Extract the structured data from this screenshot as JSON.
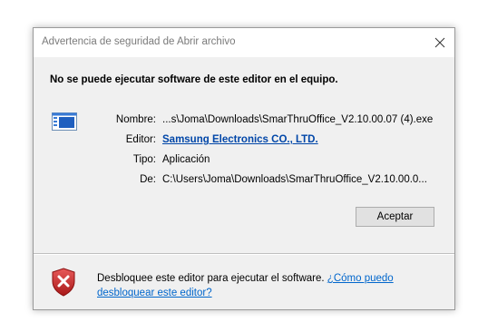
{
  "window": {
    "title": "Advertencia de seguridad de Abrir archivo",
    "close_icon": "close-icon"
  },
  "warning": "No se puede ejecutar software de este editor en el equipo.",
  "details": {
    "icon": "executable-file-icon",
    "name_label": "Nombre:",
    "name_value": "...s\\Joma\\Downloads\\SmarThruOffice_V2.10.00.07 (4).exe",
    "publisher_label": "Editor:",
    "publisher_value": "Samsung Electronics CO., LTD.",
    "type_label": "Tipo:",
    "type_value": "Aplicación",
    "from_label": "De:",
    "from_value": "C:\\Users\\Joma\\Downloads\\SmarThruOffice_V2.10.00.0..."
  },
  "buttons": {
    "accept_label": "Aceptar"
  },
  "footer": {
    "icon": "shield-error-icon",
    "text": "Desbloquee este editor para ejecutar el software. ",
    "link": "¿Cómo puedo desbloquear este editor?"
  },
  "colors": {
    "link": "#0066cc",
    "publisher_link": "#0046a8",
    "dialog_bg": "#f0f0f0",
    "shield_red": "#d22a2a"
  }
}
